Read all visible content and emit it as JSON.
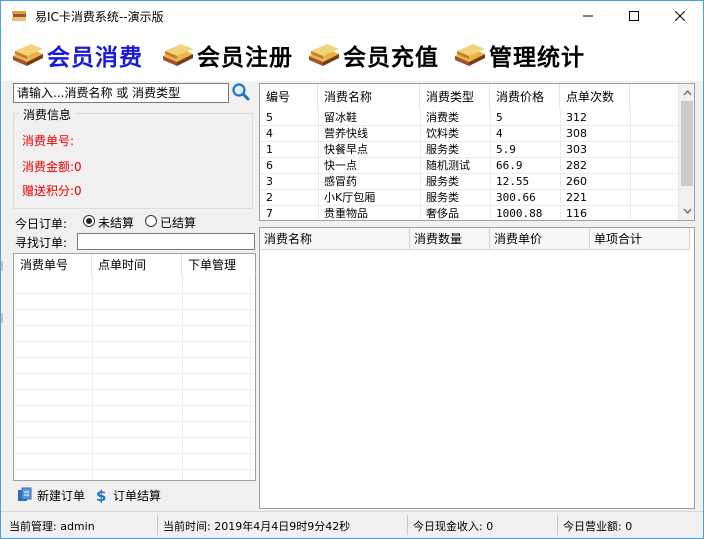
{
  "window": {
    "title": "易IC卡消费系统--演示版",
    "accent": "#4aa3df"
  },
  "menu": {
    "items": [
      {
        "label": "会员消费",
        "color": "#1a1ad8",
        "icon": "books-icon"
      },
      {
        "label": "会员注册",
        "color": "#000000",
        "icon": "books-icon"
      },
      {
        "label": "会员充值",
        "color": "#000000",
        "icon": "books-icon"
      },
      {
        "label": "管理统计",
        "color": "#000000",
        "icon": "books-icon"
      }
    ]
  },
  "search": {
    "value": "请输入...消费名称 或 消费类型"
  },
  "info": {
    "title": "消费信息",
    "order_no": "消费单号:",
    "amount": "消费金额:0",
    "points": "赠送积分:0"
  },
  "today": {
    "label": "今日订单:",
    "unsettled": "未结算",
    "settled": "已结算"
  },
  "find": {
    "label": "寻找订单:"
  },
  "orders_table": {
    "headers": [
      "消费单号",
      "点单时间",
      "下单管理"
    ]
  },
  "actions": {
    "new_order": "新建订单",
    "checkout": "订单结算"
  },
  "products_table": {
    "headers": [
      "编号",
      "消费名称",
      "消费类型",
      "消费价格",
      "点单次数"
    ],
    "rows": [
      [
        "5",
        "留冰鞋",
        "消费类",
        "5",
        "312"
      ],
      [
        "4",
        "营养快线",
        "饮料类",
        "4",
        "308"
      ],
      [
        "1",
        "快餐早点",
        "服务类",
        "5.9",
        "303"
      ],
      [
        "6",
        "快一点",
        "随机测试",
        "66.9",
        "282"
      ],
      [
        "3",
        "感冒药",
        "服务类",
        "12.55",
        "260"
      ],
      [
        "2",
        "小K厅包厢",
        "服务类",
        "300.66",
        "221"
      ],
      [
        "7",
        "贵重物品",
        "奢侈品",
        "1000.88",
        "116"
      ]
    ]
  },
  "detail_table": {
    "headers": [
      "消费名称",
      "消费数量",
      "消费单价",
      "单项合计"
    ]
  },
  "status": {
    "admin": "当前管理: admin",
    "time": "当前时间: 2019年4月4日9时9分42秒",
    "cash": "今日现金收入: 0",
    "revenue": "今日营业额: 0"
  }
}
